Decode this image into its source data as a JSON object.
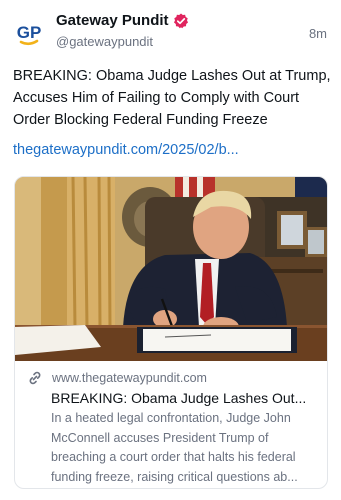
{
  "post": {
    "author_name": "Gateway Pundit",
    "author_handle": "@gatewaypundit",
    "avatar_text": "GP",
    "timestamp": "8m",
    "text": "BREAKING: Obama Judge Lashes Out at Trump, Accuses Him of Failing to Comply with Court Order Blocking Federal Funding Freeze",
    "link_text": "thegatewaypundit.com/2025/02/b..."
  },
  "link_card": {
    "domain": "www.thegatewaypundit.com",
    "title": "BREAKING: Obama Judge Lashes Out...",
    "description": "In a heated legal confrontation, Judge John McConnell accuses President Trump of breaching a court order that halts his federal funding freeze, raising critical questions ab..."
  },
  "icons": {
    "verified": "verified-badge-icon",
    "link": "link-chain-icon"
  },
  "colors": {
    "avatar_blue": "#1b4f9c",
    "avatar_gold": "#f2b21a",
    "verified_red": "#e0245e",
    "link_blue": "#1d6fc7",
    "muted": "#6b7280"
  }
}
